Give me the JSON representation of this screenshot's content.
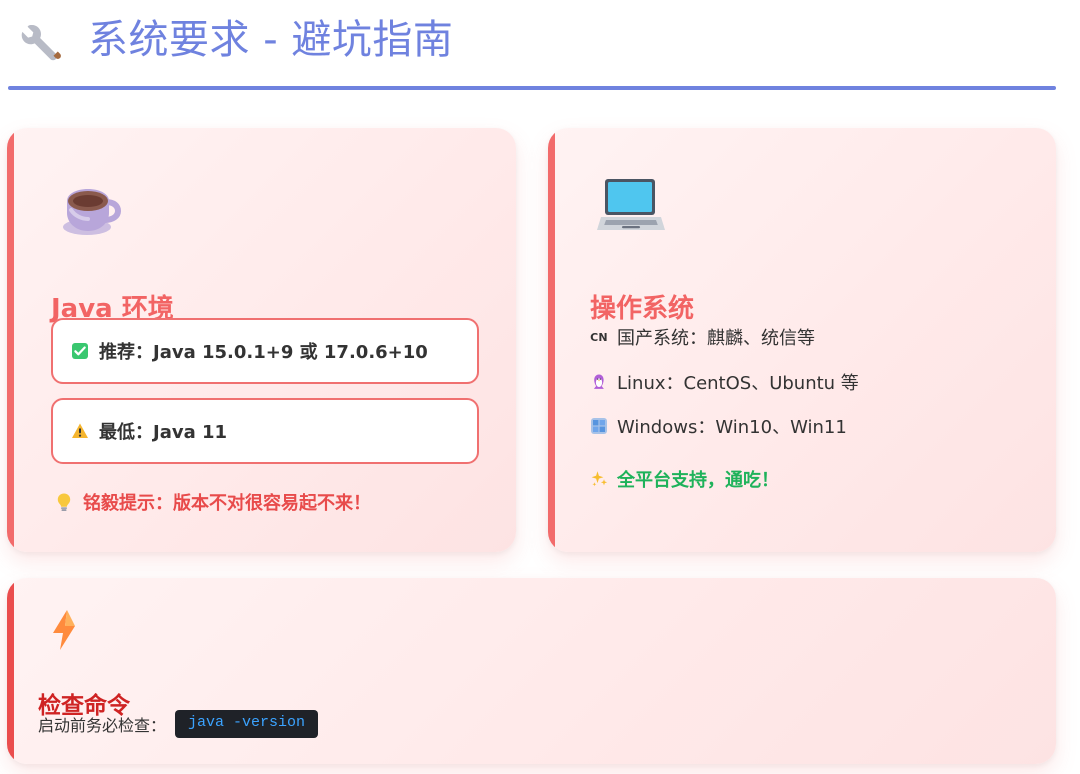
{
  "page": {
    "title": "系统要求 - 避坑指南",
    "icon": "wrench-icon",
    "accent_color": "#6f82df"
  },
  "cards": {
    "java": {
      "icon": "coffee-cup-icon",
      "title": "Java 环境",
      "recommended": {
        "icon": "check-mark-icon",
        "label": "推荐：Java 15.0.1+9 或 17.0.6+10"
      },
      "minimum": {
        "icon": "warning-icon",
        "label": "最低：Java 11"
      },
      "tip": {
        "icon": "lightbulb-icon",
        "text": "铭毅提示：版本不对很容易起不来！"
      }
    },
    "os": {
      "icon": "laptop-icon",
      "title": "操作系统",
      "items": [
        {
          "icon": "china-flag-icon",
          "badge": "CN",
          "label": "国产系统：麒麟、统信等"
        },
        {
          "icon": "penguin-icon",
          "label": "Linux：CentOS、Ubuntu 等"
        },
        {
          "icon": "windows-icon",
          "label": "Windows：Win10、Win11"
        }
      ],
      "summary": {
        "icon": "sparkles-icon",
        "label": "全平台支持，通吃！"
      }
    },
    "command": {
      "icon": "lightning-icon",
      "title": "检查命令",
      "label": "启动前务必检查：",
      "command": "java -version"
    }
  },
  "colors": {
    "card_accent": "#f26b6b",
    "command_accent": "#ea4d4d",
    "success": "#1eb25a",
    "tip": "#e84b4b",
    "command_text": "#3ba3ff"
  }
}
